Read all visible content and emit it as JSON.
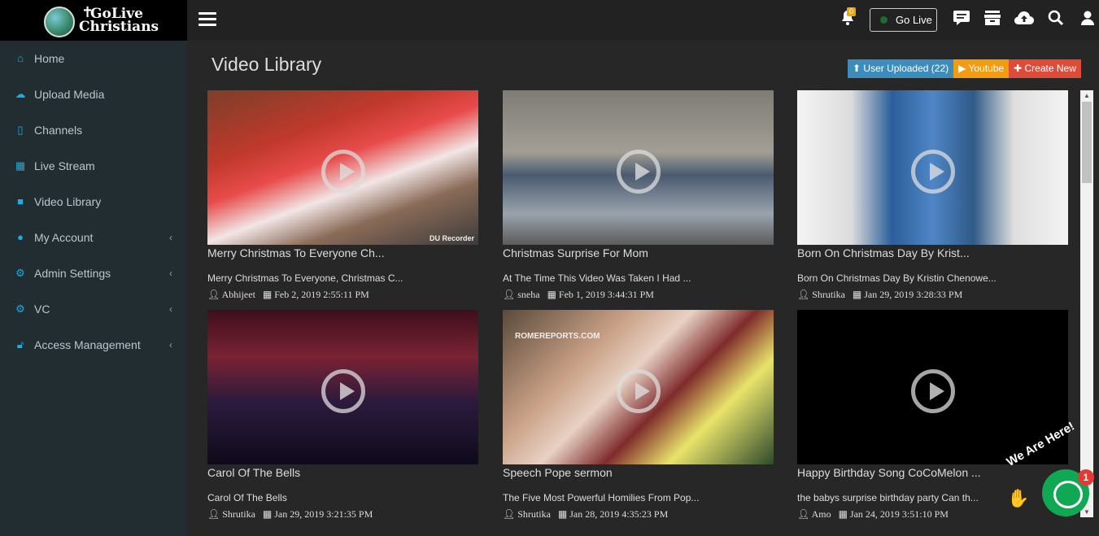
{
  "brand": {
    "line1": "GoLive",
    "line2": "Christians"
  },
  "header": {
    "notification_count": "0",
    "go_live_label": "Go Live",
    "icons": [
      "bell-icon",
      "chat-icon",
      "archive-icon",
      "cloud-upload-icon",
      "search-icon",
      "user-icon"
    ]
  },
  "sidebar": {
    "items": [
      {
        "label": "Home",
        "icon": "home-icon"
      },
      {
        "label": "Upload Media",
        "icon": "cloud-upload-icon"
      },
      {
        "label": "Channels",
        "icon": "bookmark-icon"
      },
      {
        "label": "Live Stream",
        "icon": "calendar-icon"
      },
      {
        "label": "Video Library",
        "icon": "video-camera-icon"
      },
      {
        "label": "My Account",
        "icon": "user-icon"
      },
      {
        "label": "Admin Settings",
        "icon": "cogs-icon"
      },
      {
        "label": "VC",
        "icon": "cogs-icon"
      },
      {
        "label": "Access Management",
        "icon": "lock-icon"
      }
    ]
  },
  "main": {
    "title": "Video Library",
    "tabs": {
      "user_uploaded": "User Uploaded (22)",
      "youtube": "Youtube",
      "create_new": "Create New"
    },
    "videos": [
      {
        "title": "Merry Christmas To Everyone Ch...",
        "description": "Merry Christmas To Everyone, Christmas C...",
        "user": "Abhijeet",
        "date": "Feb 2, 2019 2:55:11 PM",
        "watermark": "DU Recorder"
      },
      {
        "title": "Christmas Surprise For Mom",
        "description": "At The Time This Video Was Taken I Had ...",
        "user": "sneha",
        "date": "Feb 1, 2019 3:44:31 PM"
      },
      {
        "title": "Born On Christmas Day By Krist...",
        "description": "Born On Christmas Day By Kristin Chenowe...",
        "user": "Shrutika",
        "date": "Jan 29, 2019 3:28:33 PM"
      },
      {
        "title": "Carol Of The Bells",
        "description": "Carol Of The Bells",
        "user": "Shrutika",
        "date": "Jan 29, 2019 3:21:35 PM"
      },
      {
        "title": "Speech Pope sermon",
        "description": "The Five Most Powerful Homilies From Pop...",
        "user": "Shrutika",
        "date": "Jan 28, 2019 4:35:23 PM",
        "watermark": "ROMEREPORTS.COM"
      },
      {
        "title": "Happy Birthday Song CoCoMelon ...",
        "description": "the babys surprise birthday party Can th...",
        "user": "Amo",
        "date": "Jan 24, 2019 3:51:10 PM"
      }
    ]
  },
  "chat_widget": {
    "label": "We Are Here!",
    "badge": "1"
  },
  "colors": {
    "accent": "#21a9e1",
    "sidebar_bg": "#222d32",
    "user_tab": "#3c8dbc",
    "youtube_tab": "#f39c12",
    "create_tab": "#dd4b39",
    "chat": "#11a853"
  }
}
